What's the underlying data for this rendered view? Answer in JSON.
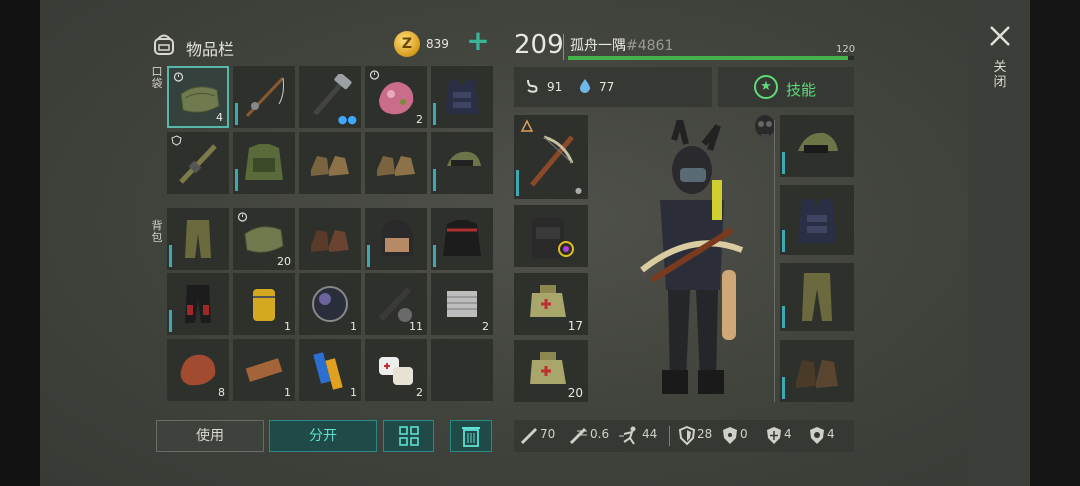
{
  "inventory": {
    "title": "物品栏",
    "coins": "839",
    "pocket_label": "口袋",
    "backpack_label": "背包",
    "pocket_items": [
      {
        "icon": "cloth-icon",
        "count": "4"
      },
      {
        "icon": "fishing-rod-icon",
        "count": ""
      },
      {
        "icon": "hammer-icon",
        "count": ""
      },
      {
        "icon": "ore-icon",
        "count": "2"
      },
      {
        "icon": "vest-icon",
        "count": ""
      },
      {
        "icon": "rifle-icon",
        "count": ""
      },
      {
        "icon": "jacket-icon",
        "count": ""
      },
      {
        "icon": "boots-icon",
        "count": ""
      },
      {
        "icon": "boots-icon",
        "count": ""
      },
      {
        "icon": "cap-icon",
        "count": ""
      }
    ],
    "backpack_items": [
      {
        "icon": "pants-icon",
        "count": ""
      },
      {
        "icon": "cloth-icon",
        "count": "20"
      },
      {
        "icon": "boots-icon",
        "count": ""
      },
      {
        "icon": "helmet-icon",
        "count": ""
      },
      {
        "icon": "moto-jacket-icon",
        "count": ""
      },
      {
        "icon": "moto-pants-icon",
        "count": ""
      },
      {
        "icon": "filter-icon",
        "count": "1"
      },
      {
        "icon": "lens-icon",
        "count": "1"
      },
      {
        "icon": "parts-icon",
        "count": "11"
      },
      {
        "icon": "engine-part-icon",
        "count": "2"
      },
      {
        "icon": "meat-icon",
        "count": "8"
      },
      {
        "icon": "plank-icon",
        "count": "1"
      },
      {
        "icon": "battery-icon",
        "count": "1"
      },
      {
        "icon": "bandage-icon",
        "count": "2"
      },
      {
        "icon": "empty",
        "count": ""
      }
    ]
  },
  "buttons": {
    "use": "使用",
    "split": "分开"
  },
  "player": {
    "level": "209",
    "name": "孤舟一隅",
    "tag": "#4861",
    "hp": "120",
    "hp_fraction": 0.98,
    "hunger": "91",
    "thirst": "77",
    "skills_label": "技能"
  },
  "equipment": {
    "left": [
      {
        "icon": "crossbow-icon",
        "count": ""
      },
      {
        "icon": "backpack-icon",
        "count": ""
      },
      {
        "icon": "medkit-icon",
        "count": "17"
      },
      {
        "icon": "medkit-icon",
        "count": "20"
      }
    ],
    "right": [
      {
        "icon": "cap-icon"
      },
      {
        "icon": "vest-icon"
      },
      {
        "icon": "pants-icon"
      },
      {
        "icon": "boots-icon"
      }
    ]
  },
  "stats": {
    "damage": "70",
    "attack_speed": "0.6",
    "speed": "44",
    "armor": "28",
    "radiation": "0",
    "cold": "4",
    "toxic": "4"
  },
  "close_label": "关闭",
  "colors": {
    "accent": "#3ea8b4",
    "skill": "#5edb7a",
    "hp": "#46b34a",
    "button_teal": "#1f4a47"
  }
}
